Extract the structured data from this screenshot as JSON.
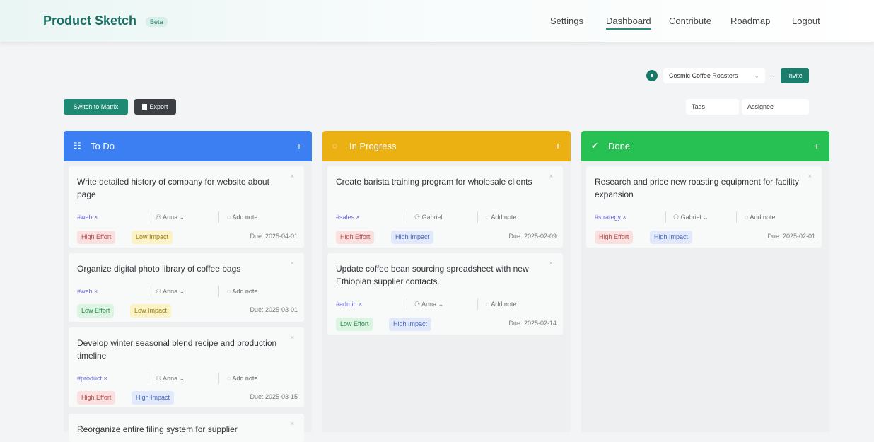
{
  "header": {
    "brand": "Product Sketch",
    "badge": "Beta",
    "nav": [
      "Settings",
      "Dashboard",
      "Contribute",
      "Roadmap",
      "Logout"
    ],
    "active_nav": "Dashboard"
  },
  "org": {
    "selected": "Cosmic Coffee Roasters",
    "invite_label": "Invite"
  },
  "toolbar": {
    "matrix_label": "Switch to Matrix",
    "export_label": "Export",
    "tags_filter": "Tags",
    "assignee_filter": "Assignee"
  },
  "columns": [
    {
      "title": "To Do",
      "color": "#3b7ff3",
      "cards": [
        {
          "title": "Write detailed history of company for website about page",
          "tag": "#web",
          "assignee": "Anna",
          "note": "Add note",
          "effort": "High Effort",
          "impact": "Low Impact",
          "due": "Due: 2025-04-01"
        },
        {
          "title": "Organize digital photo library of coffee bags",
          "tag": "#web",
          "assignee": "Anna",
          "note": "Add note",
          "effort": "Low Effort",
          "impact": "Low Impact",
          "due": "Due: 2025-03-01"
        },
        {
          "title": "Develop winter seasonal blend recipe and production timeline",
          "tag": "#product",
          "assignee": "Anna",
          "note": "Add note",
          "effort": "High Effort",
          "impact": "High Impact",
          "due": "Due: 2025-03-15"
        },
        {
          "title": "Reorganize entire filing system for supplier"
        }
      ]
    },
    {
      "title": "In Progress",
      "color": "#ebb113",
      "cards": [
        {
          "title": "Create barista training program for wholesale clients",
          "tag": "#sales",
          "assignee": "Gabriel",
          "note": "Add note",
          "effort": "High Effort",
          "impact": "High Impact",
          "due": "Due: 2025-02-09"
        },
        {
          "title": "Update coffee bean sourcing spreadsheet with new Ethiopian supplier contacts.",
          "tag": "#admin",
          "assignee": "Anna",
          "note": "Add note",
          "effort": "Low Effort",
          "impact": "High Impact",
          "due": "Due: 2025-02-14"
        }
      ]
    },
    {
      "title": "Done",
      "color": "#27c052",
      "cards": [
        {
          "title": "Research and price new roasting equipment for facility expansion",
          "tag": "#strategy",
          "assignee": "Gabriel",
          "note": "Add note",
          "effort": "High Effort",
          "impact": "High Impact",
          "due": "Due: 2025-02-01"
        }
      ]
    }
  ],
  "icons": {
    "todo": "checklist-icon",
    "inprogress": "spinner-icon",
    "done": "double-check-icon",
    "add": "plus-icon",
    "close": "x-icon",
    "user": "user-icon",
    "note": "comment-icon",
    "export": "file-icon"
  }
}
